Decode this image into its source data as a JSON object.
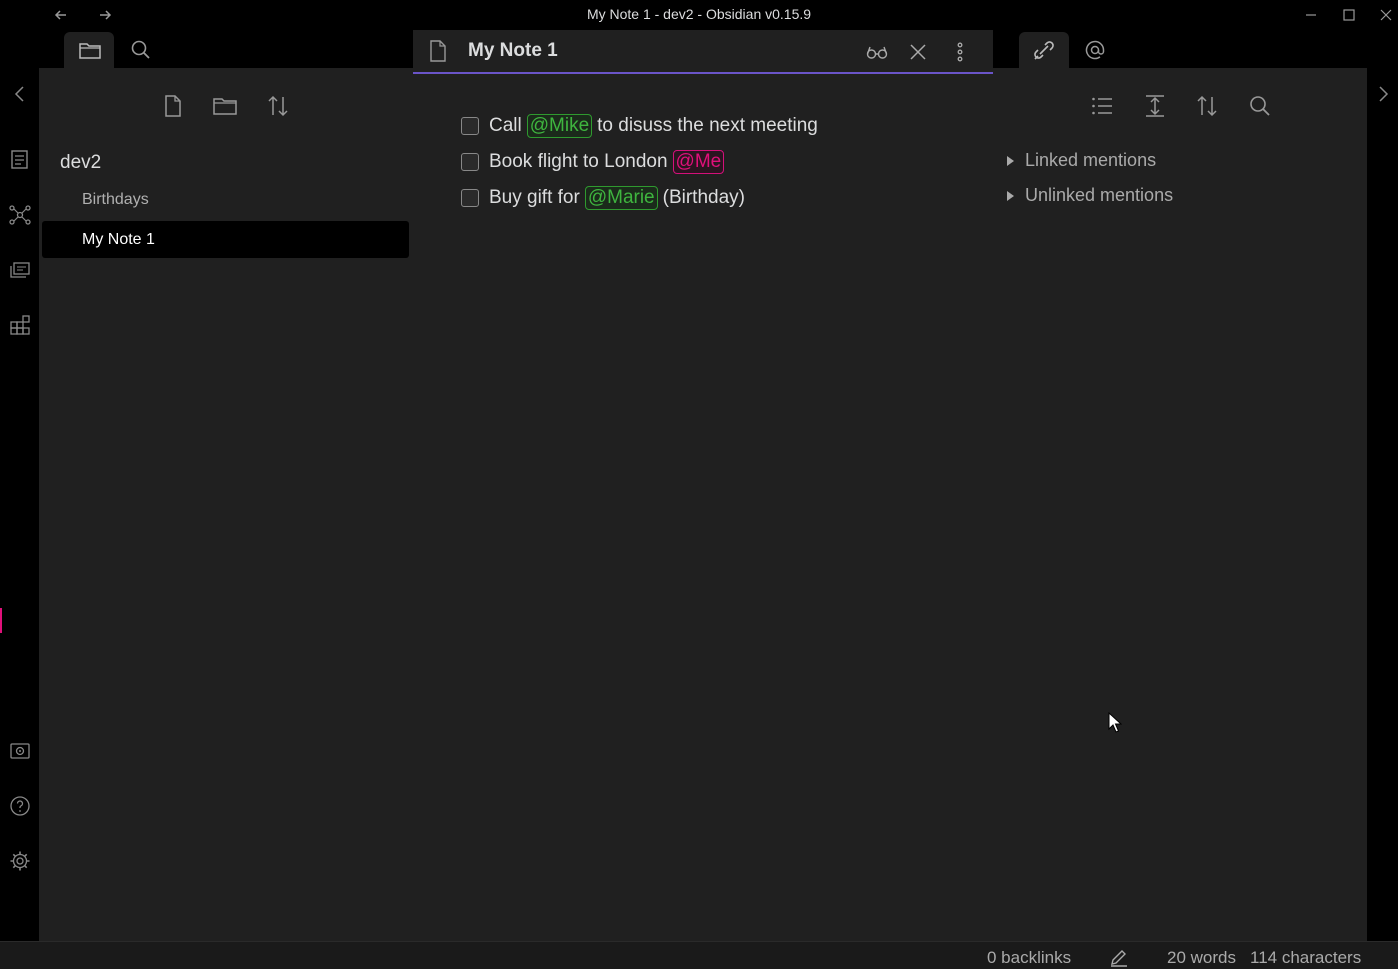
{
  "window": {
    "title": "My Note 1 - dev2 - Obsidian v0.15.9"
  },
  "title_controls": [
    "back-arrow-icon",
    "forward-arrow-icon",
    "minimize-icon",
    "maximize-icon",
    "close-icon"
  ],
  "ribbon": {
    "icons": [
      "collapse-left-icon",
      "daily-note-icon",
      "graph-view-icon",
      "slides-icon",
      "plugin-grid-icon",
      "vault-icon",
      "help-icon",
      "settings-icon"
    ]
  },
  "left_panel": {
    "tabs": [
      "folder-icon",
      "search-icon"
    ],
    "toolbar": [
      "new-note-icon",
      "new-folder-icon",
      "sort-icon"
    ],
    "vault_name": "dev2",
    "files": [
      {
        "label": "Birthdays",
        "active": false
      },
      {
        "label": "My Note 1",
        "active": true
      }
    ]
  },
  "editor": {
    "note_title": "My Note 1",
    "header_icons": [
      "note-file-icon",
      "reading-view-icon",
      "close-tab-icon",
      "more-options-icon"
    ],
    "tasks": [
      {
        "before": "Call",
        "mention": "@Mike",
        "after": "to disuss the next meeting",
        "mention_color": "#3fb53f"
      },
      {
        "before": "Book flight to London",
        "mention": "@Me",
        "after": "",
        "mention_color": "#e0107a"
      },
      {
        "before": "Buy gift for",
        "mention": "@Marie",
        "after": "(Birthday)",
        "mention_color": "#3fb53f"
      }
    ]
  },
  "right_panel": {
    "tabs": [
      "backlinks-icon",
      "mentions-at-icon"
    ],
    "toolbar": [
      "list-icon",
      "expand-icon",
      "sort-icon",
      "search-icon"
    ],
    "sections": [
      "Linked mentions",
      "Unlinked mentions"
    ]
  },
  "status_bar": {
    "backlinks": "0 backlinks",
    "words": "20 words",
    "characters": "114 characters"
  },
  "colors": {
    "accent": "#6a54c8",
    "mention_green": "#3fb53f",
    "mention_pink": "#e0107a",
    "background": "#202020"
  }
}
